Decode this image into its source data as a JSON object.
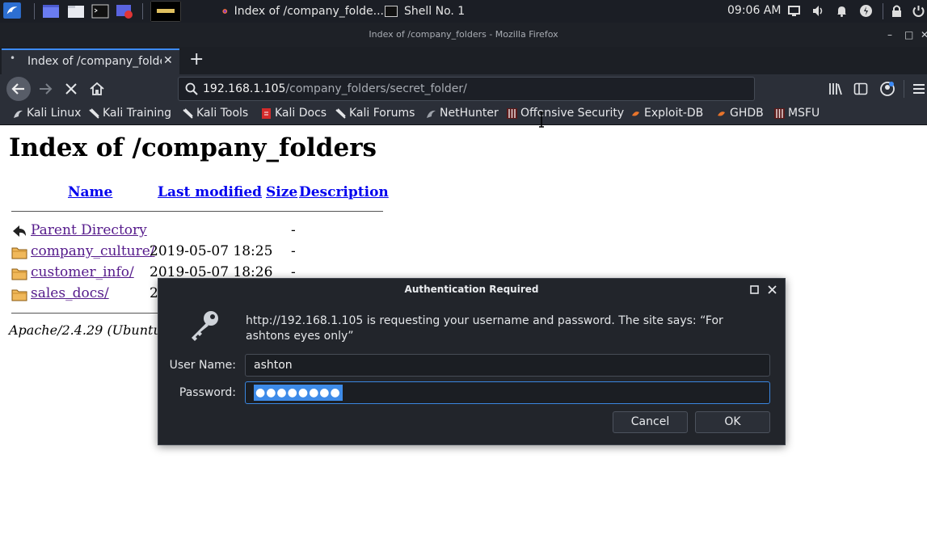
{
  "taskbar": {
    "windows": [
      {
        "label": "Index of /company_folde..."
      },
      {
        "label": "Shell No. 1"
      }
    ],
    "clock": "09:06 AM"
  },
  "window": {
    "title": "Index of /company_folders - Mozilla Firefox"
  },
  "tab": {
    "label": "Index of /company_folde",
    "new_tab_symbol": "+"
  },
  "urlbar": {
    "host": "192.168.1.105",
    "path": "/company_folders/secret_folder/"
  },
  "bookmarks": [
    {
      "label": "Kali Linux",
      "icon": "kali-dragon-icon"
    },
    {
      "label": "Kali Training",
      "icon": "kali-dragon-icon"
    },
    {
      "label": "Kali Tools",
      "icon": "kali-dragon-icon"
    },
    {
      "label": "Kali Docs",
      "icon": "kali-docs-icon"
    },
    {
      "label": "Kali Forums",
      "icon": "kali-dragon-icon"
    },
    {
      "label": "NetHunter",
      "icon": "nethunter-icon"
    },
    {
      "label": "Offensive Security",
      "icon": "offsec-icon"
    },
    {
      "label": "Exploit-DB",
      "icon": "exploitdb-icon"
    },
    {
      "label": "GHDB",
      "icon": "ghdb-icon"
    },
    {
      "label": "MSFU",
      "icon": "msfu-icon"
    }
  ],
  "page": {
    "heading": "Index of /company_folders",
    "columns": {
      "name": "Name",
      "last_modified": "Last modified",
      "size": "Size",
      "description": "Description"
    },
    "rows": [
      {
        "name": "Parent Directory",
        "date": "",
        "size": "-",
        "icon": "back-arrow-icon"
      },
      {
        "name": "company_culture/",
        "date": "2019-05-07 18:25",
        "size": "-",
        "icon": "folder-icon"
      },
      {
        "name": "customer_info/",
        "date": "2019-05-07 18:26",
        "size": "-",
        "icon": "folder-icon"
      },
      {
        "name": "sales_docs/",
        "date": "2",
        "size": "",
        "icon": "folder-icon"
      }
    ],
    "address": "Apache/2.4.29 (Ubuntu"
  },
  "dialog": {
    "title": "Authentication Required",
    "message": "http://192.168.1.105 is requesting your username and password. The site says: “For ashtons eyes only”",
    "username_label": "User Name:",
    "username_value": "ashton",
    "password_label": "Password:",
    "password_value": "●●●●●●●●",
    "cancel_label": "Cancel",
    "ok_label": "OK"
  },
  "colors": {
    "accent": "#3d8bf7",
    "link_visited": "#551a8b",
    "link": "#0000ee"
  }
}
